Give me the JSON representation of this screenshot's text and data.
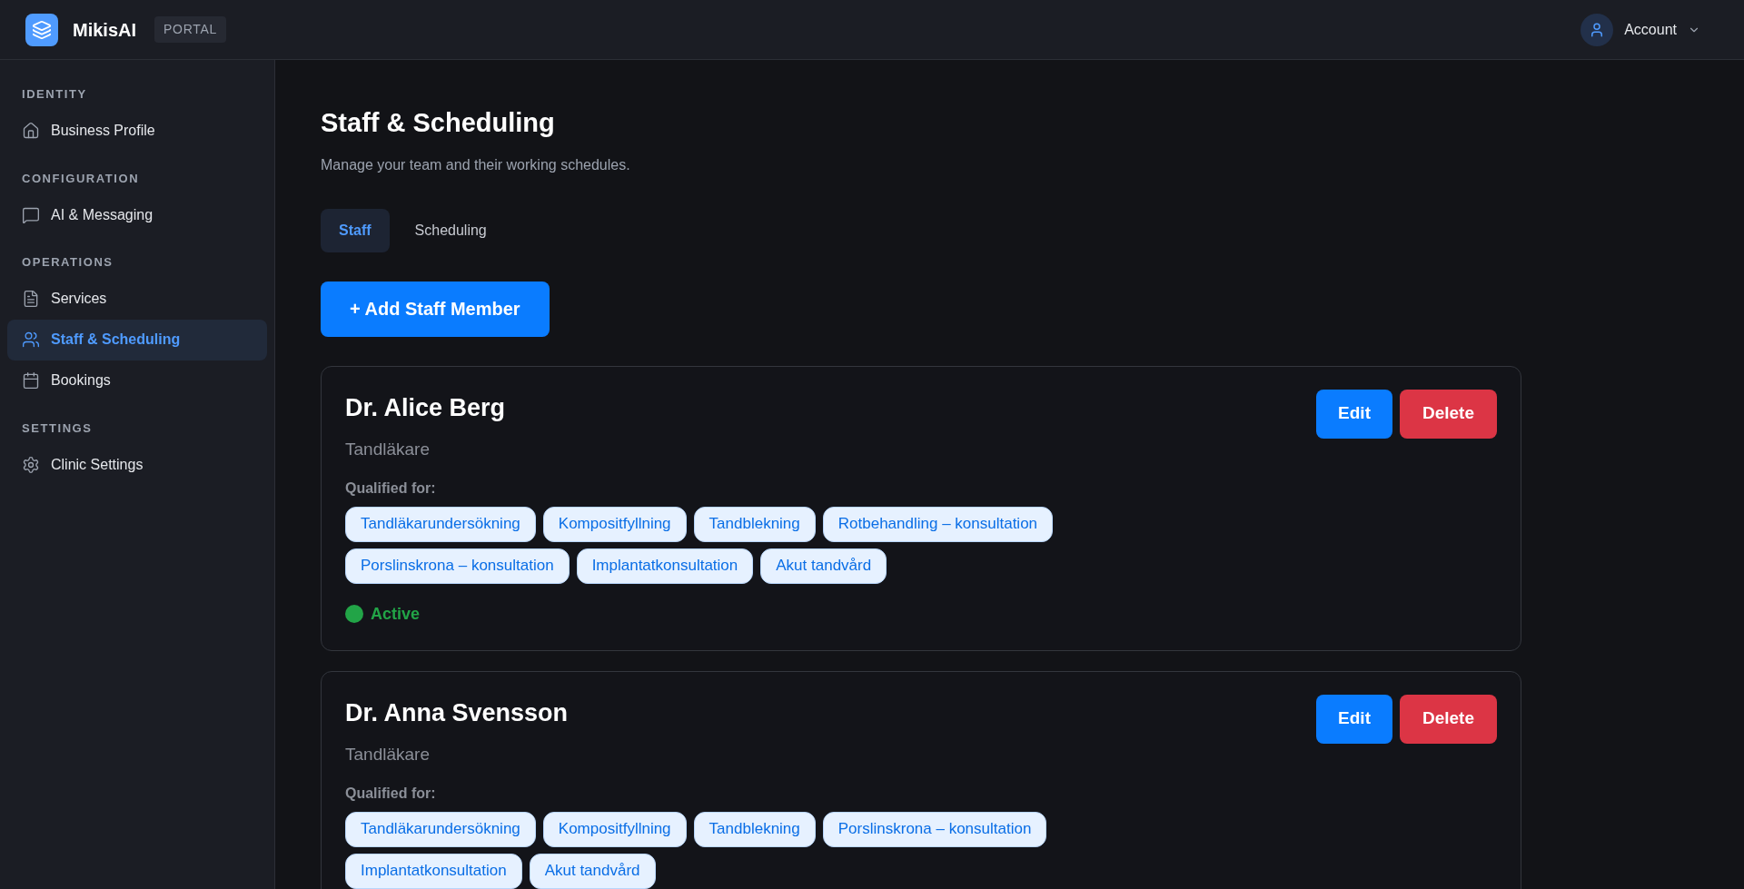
{
  "header": {
    "brand": "MikisAI",
    "badge": "PORTAL",
    "account": "Account"
  },
  "sidebar": {
    "sections": [
      {
        "title": "IDENTITY",
        "items": [
          {
            "label": "Business Profile",
            "selected": false
          }
        ]
      },
      {
        "title": "CONFIGURATION",
        "items": [
          {
            "label": "AI & Messaging",
            "selected": false
          }
        ]
      },
      {
        "title": "OPERATIONS",
        "items": [
          {
            "label": "Services",
            "selected": false
          },
          {
            "label": "Staff & Scheduling",
            "selected": true
          },
          {
            "label": "Bookings",
            "selected": false
          }
        ]
      },
      {
        "title": "SETTINGS",
        "items": [
          {
            "label": "Clinic Settings",
            "selected": false
          }
        ]
      }
    ]
  },
  "page": {
    "title": "Staff & Scheduling",
    "subtitle": "Manage your team and their working schedules.",
    "tabs": [
      {
        "label": "Staff",
        "selected": true
      },
      {
        "label": "Scheduling",
        "selected": false
      }
    ],
    "add_button": "+ Add Staff Member",
    "staff": [
      {
        "name": "Dr. Alice Berg",
        "role": "Tandläkare",
        "qualified_label": "Qualified for:",
        "services": [
          "Tandläkarundersökning",
          "Kompositfyllning",
          "Tandblekning",
          "Rotbehandling – konsultation",
          "Porslinskrona – konsultation",
          "Implantatkonsultation",
          "Akut tandvård"
        ],
        "status": {
          "label": "Active",
          "active": true
        },
        "edit": "Edit",
        "delete": "Delete"
      },
      {
        "name": "Dr. Anna Svensson",
        "role": "Tandläkare",
        "qualified_label": "Qualified for:",
        "services": [
          "Tandläkarundersökning",
          "Kompositfyllning",
          "Tandblekning",
          "Porslinskrona – konsultation",
          "Implantatkonsultation",
          "Akut tandvård"
        ],
        "edit": "Edit",
        "delete": "Delete"
      }
    ]
  }
}
